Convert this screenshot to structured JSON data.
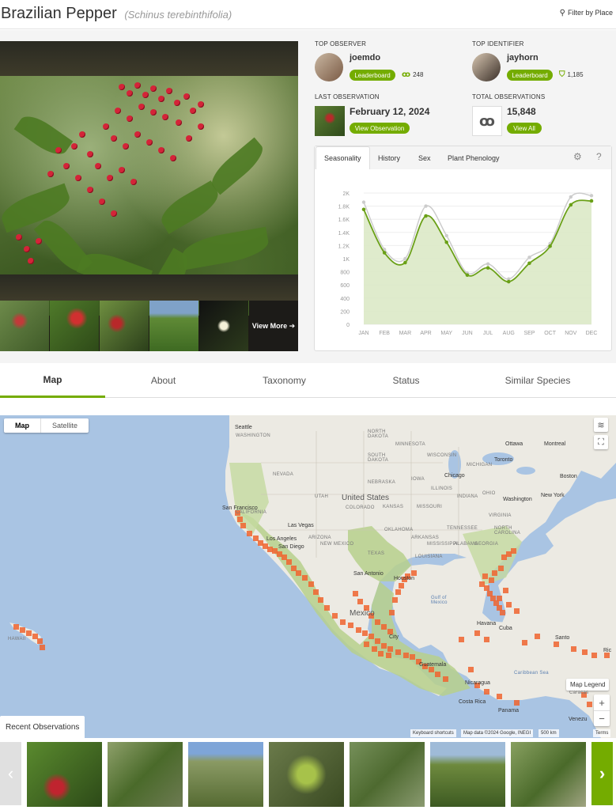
{
  "header": {
    "common_name": "Brazilian Pepper",
    "scientific_name": "(Schinus terebinthifolia)",
    "filter": "Filter by Place"
  },
  "photo": {
    "view_more": "View More"
  },
  "stats": {
    "top_observer": {
      "label": "TOP OBSERVER",
      "name": "joemdo",
      "button": "Leaderboard",
      "count": "248"
    },
    "top_identifier": {
      "label": "TOP IDENTIFIER",
      "name": "jayhorn",
      "button": "Leaderboard",
      "count": "1,185"
    },
    "last_observation": {
      "label": "LAST OBSERVATION",
      "date": "February 12, 2024",
      "button": "View Observation"
    },
    "total_observations": {
      "label": "TOTAL OBSERVATIONS",
      "count": "15,848",
      "button": "View All"
    }
  },
  "chart_tabs": [
    "Seasonality",
    "History",
    "Sex",
    "Plant Phenology"
  ],
  "chart_data": {
    "type": "area",
    "categories": [
      "JAN",
      "FEB",
      "MAR",
      "APR",
      "MAY",
      "JUN",
      "JUL",
      "AUG",
      "SEP",
      "OCT",
      "NOV",
      "DEC"
    ],
    "y_tick_labels": [
      "0",
      "200",
      "400",
      "600",
      "800",
      "1K",
      "1.2K",
      "1.4K",
      "1.6K",
      "1.8K",
      "2K"
    ],
    "ylim": [
      0,
      2000
    ],
    "series": [
      {
        "color": "#6aa017",
        "values": [
          1750,
          1090,
          940,
          1650,
          1250,
          750,
          860,
          650,
          930,
          1190,
          1820,
          1880
        ]
      },
      {
        "color": "#cccccc",
        "values": [
          1860,
          1140,
          1000,
          1800,
          1350,
          780,
          920,
          690,
          1020,
          1230,
          1940,
          1960
        ]
      }
    ],
    "grid": true
  },
  "section_tabs": [
    "Map",
    "About",
    "Taxonomy",
    "Status",
    "Similar Species"
  ],
  "map": {
    "type_map": "Map",
    "type_satellite": "Satellite",
    "legend": "Map Legend",
    "zoom_in": "+",
    "zoom_out": "−",
    "attr_shortcuts": "Keyboard shortcuts",
    "attr_data": "Map data ©2024 Google, INEGI",
    "attr_scale": "500 km",
    "attr_terms": "Terms",
    "labels": {
      "seattle": "Seattle",
      "washington": "WASHINGTON",
      "north_dakota": "NORTH\nDAKOTA",
      "minnesota": "MINNESOTA",
      "ottawa": "Ottawa",
      "montreal": "Montreal",
      "south_dakota": "SOUTH\nDAKOTA",
      "wisconsin": "WISCONSIN",
      "toronto": "Toronto",
      "michigan": "MICHIGAN",
      "nevada": "NEVADA",
      "nebraska": "NEBRASKA",
      "iowa": "IOWA",
      "chicago": "Chicago",
      "boston": "Boston",
      "united_states": "United States",
      "utah": "UTAH",
      "illinois": "ILLINOIS",
      "indiana": "INDIANA",
      "ohio": "OHIO",
      "new_york": "New York",
      "san_francisco": "San Francisco",
      "colorado": "COLORADO",
      "kansas": "KANSAS",
      "missouri": "MISSOURI",
      "washington_city": "Washington",
      "california": "CALIFORNIA",
      "las_vegas": "Las Vegas",
      "virginia": "VIRGINIA",
      "oklahoma": "OKLAHOMA",
      "tennessee": "TENNESSEE",
      "north_carolina": "NORTH\nCAROLINA",
      "los_angeles": "Los Angeles",
      "san_diego": "San Diego",
      "arizona": "ARIZONA",
      "new_mexico": "NEW MEXICO",
      "arkansas": "ARKANSAS",
      "mississippi": "MISSISSIPPI",
      "alabama": "ALABAMA",
      "georgia": "GEORGIA",
      "texas": "TEXAS",
      "louisiana": "LOUISIANA",
      "san_antonio": "San Antonio",
      "houston": "Houston",
      "gulf_of_mexico": "Gulf of\nMexico",
      "hawaii": "HAWAII",
      "mexico": "Mexico",
      "mexico_city": "City",
      "havana": "Havana",
      "cuba": "Cuba",
      "santo": "Santo",
      "puerto_rico": "Ric",
      "guatemala": "Guatemala",
      "nicaragua": "Nicaragua",
      "caribbean_sea": "Caribbean Sea",
      "caracas": "Caracas",
      "costa_rica": "Costa Rica",
      "panama": "Panama",
      "venezuela": "Venezu"
    }
  },
  "recent": {
    "label": "Recent Observations",
    "prev": "‹",
    "next": "›"
  }
}
